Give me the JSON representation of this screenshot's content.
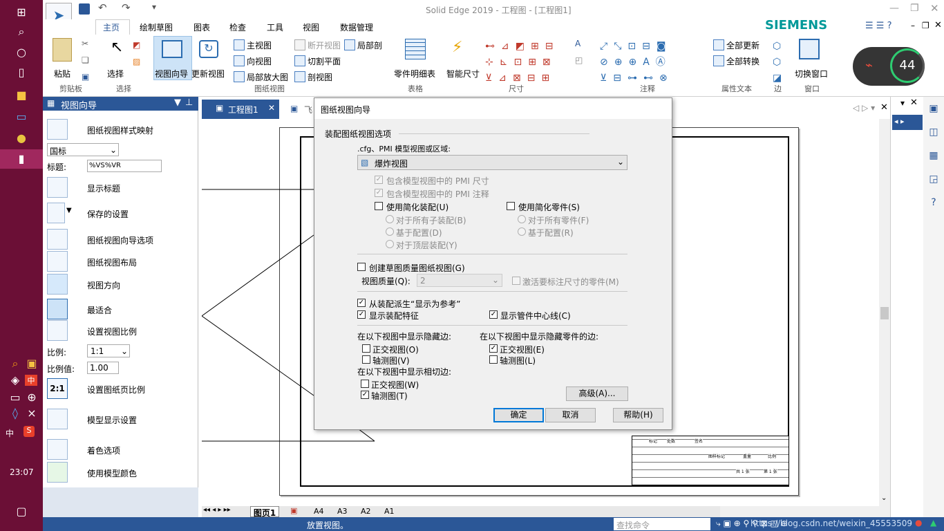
{
  "taskbar": {
    "time": "23:07",
    "ime": "中"
  },
  "titlebar": {
    "title": "Solid Edge 2019 - 工程图 - [工程图1]",
    "brand": "SIEMENS"
  },
  "ribbon": {
    "tabs": [
      "主页",
      "绘制草图",
      "图表",
      "检查",
      "工具",
      "视图",
      "数据管理"
    ],
    "paste": "粘贴",
    "clipboard_group": "剪贴板",
    "select": "选择",
    "select_group": "选择",
    "view_wizard": "视图向导",
    "update_view": "更新视图",
    "main_view": "主视图",
    "proj_view": "向视图",
    "detail_view": "局部放大图",
    "broken_view": "断开视图",
    "cut_plane": "切割平面",
    "section_view": "剖视图",
    "broken_out": "局部剖",
    "drawing_views_group": "图纸视图",
    "parts_list": "零件明细表",
    "table_group": "表格",
    "smart_dim": "智能尺寸",
    "dim_group": "尺寸",
    "annot_group": "注释",
    "update_all": "全部更新",
    "convert_all": "全部转换",
    "prop_text_group": "属性文本",
    "edge_group": "边",
    "switch_window": "切换窗口",
    "window_group": "窗口",
    "netspeed": "44"
  },
  "leftpane": {
    "header": "视图向导",
    "style_map": "图纸视图样式映射",
    "standard": "国标",
    "title_label": "标题:",
    "title_value": "%VS%VR",
    "show_title": "显示标题",
    "saved_settings": "保存的设置",
    "wizard_options": "图纸视图向导选项",
    "layout": "图纸视图布局",
    "orientation": "视图方向",
    "best_fit": "最适合",
    "set_scale": "设置视图比例",
    "scale_label": "比例:",
    "scale_value": "1:1",
    "scale_value_label": "比例值:",
    "scale_value_num": "1.00",
    "set_sheet_scale": "设置图纸页比例",
    "model_display": "模型显示设置",
    "shading": "着色选项",
    "model_color": "使用模型颜色"
  },
  "doc_tabs": [
    "工程图1",
    "飞"
  ],
  "sheet_tabs": [
    "图页1",
    "A4",
    "A3",
    "A2",
    "A1"
  ],
  "status": {
    "text": "放置视图。",
    "search_placeholder": "查找命令",
    "watermark": "https://blog.csdn.net/weixin_45553509"
  },
  "title_block": {
    "a": "标记",
    "b": "处数",
    "c": "签名",
    "d": "图样标记",
    "e": "重量",
    "f": "比例",
    "g": "共 1 张",
    "h": "第 1 张"
  },
  "dialog": {
    "title": "图纸视图向导",
    "section": "装配图纸视图选项",
    "cfg_label": ".cfg、PMI 模型视图或区域:",
    "cfg_value": "爆炸视图",
    "pmi_dim": "包含模型视图中的 PMI 尺寸",
    "pmi_annot": "包含模型视图中的 PMI 注释",
    "simp_asm": "使用简化装配(U)",
    "simp_part": "使用简化零件(S)",
    "all_subasm": "对于所有子装配(B)",
    "all_parts": "对于所有零件(F)",
    "based_cfg1": "基于配置(D)",
    "based_cfg2": "基于配置(R)",
    "top_asm": "对于顶层装配(Y)",
    "draft_quality": "创建草图质量图纸视图(G)",
    "view_quality": "视图质量(Q):",
    "quality_value": "2",
    "activate_parts": "激活要标注尺寸的零件(M)",
    "derive_ref": "从装配派生“显示为参考”",
    "show_asm_feat": "显示装配特征",
    "show_pipe_center": "显示管件中心线(C)",
    "hidden_edges": "在以下视图中显示隐藏边:",
    "hidden_part_edges": "在以下视图中显示隐藏零件的边:",
    "ortho1": "正交视图(O)",
    "iso1": "轴测图(V)",
    "ortho2": "正交视图(E)",
    "iso2": "轴测图(L)",
    "tangent": "在以下视图中显示相切边:",
    "ortho3": "正交视图(W)",
    "iso3": "轴测图(T)",
    "advanced": "高级(A)...",
    "ok": "确定",
    "cancel": "取消",
    "help": "帮助(H)"
  }
}
